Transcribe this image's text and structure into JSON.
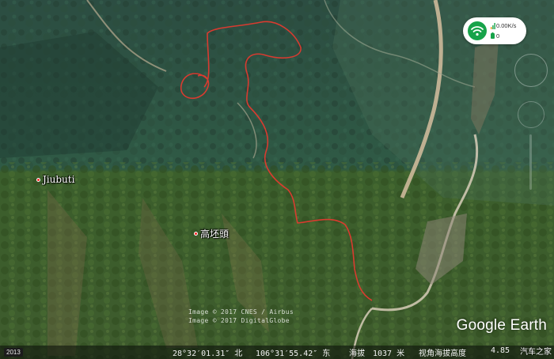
{
  "map": {
    "places": [
      {
        "name": "Jiubuti"
      },
      {
        "name": "高坯頭"
      }
    ],
    "attribution": {
      "line1": "Image © 2017 CNES / Airbus",
      "line2": "Image © 2017 DigitalGlobe"
    },
    "brand": "Google Earth",
    "imagery_year": "2013",
    "route_color": "#e23a2f"
  },
  "status_bar": {
    "latitude": "28°32′01.31″ 北",
    "longitude": "106°31′55.42″ 东",
    "elevation_label": "海拔",
    "elevation_value": "1037 米",
    "eye_altitude_label": "视角海拔高度",
    "eye_altitude_value": "4.85"
  },
  "overlay": {
    "network_speed": "0.00K/s",
    "count": "0",
    "wifi_color": "#17a34a"
  },
  "watermark": "汽车之家"
}
